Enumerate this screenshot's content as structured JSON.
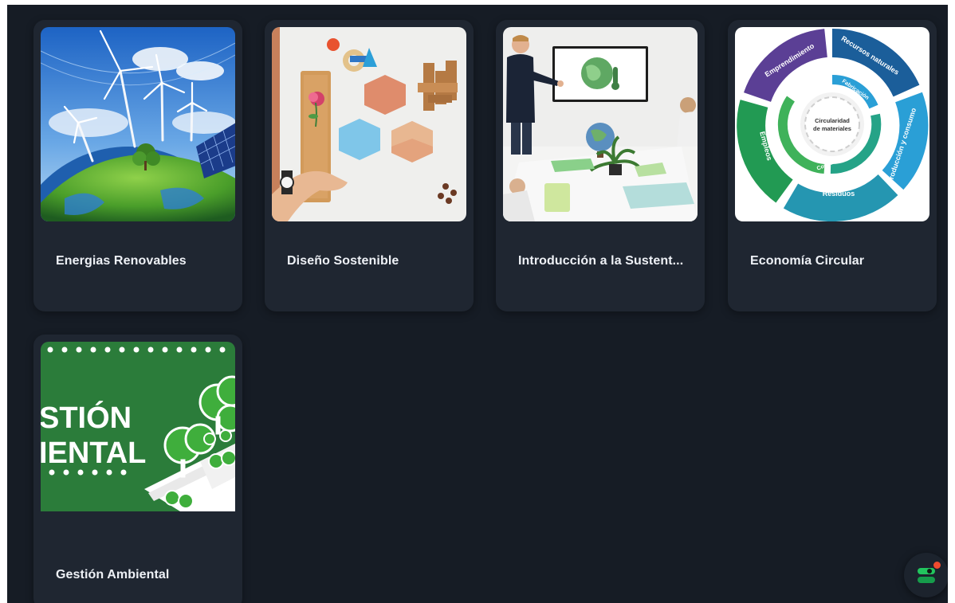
{
  "courses": [
    {
      "title": "Energias Renovables",
      "image": "wind-turbines-earth"
    },
    {
      "title": "Diseño Sostenible",
      "image": "sustainable-materials"
    },
    {
      "title": "Introducción a la Sustent...",
      "image": "presentation-meeting"
    },
    {
      "title": "Economía Circular",
      "image": "circular-economy-diagram"
    },
    {
      "title": "Gestión Ambiental",
      "image": "gestion-ambiental-banner"
    }
  ],
  "diagram": {
    "center_line1": "Circularidad",
    "center_line2": "de materiales",
    "outer": [
      "Recursos naturales",
      "Producción y consumo",
      "Residuos",
      "Empleos",
      "Emprendimiento"
    ],
    "inner": [
      "Fabricación",
      "Consumo y uso",
      "Reciclaje"
    ]
  },
  "banner": {
    "line1": "STIÓN",
    "line2": "IENTAL"
  },
  "widget": {
    "icon": "toggle-icon",
    "has_notification": true
  },
  "colors": {
    "background": "#161c25",
    "card": "#1f2631",
    "accent": "#22c55e",
    "notification": "#ef4b2f"
  }
}
